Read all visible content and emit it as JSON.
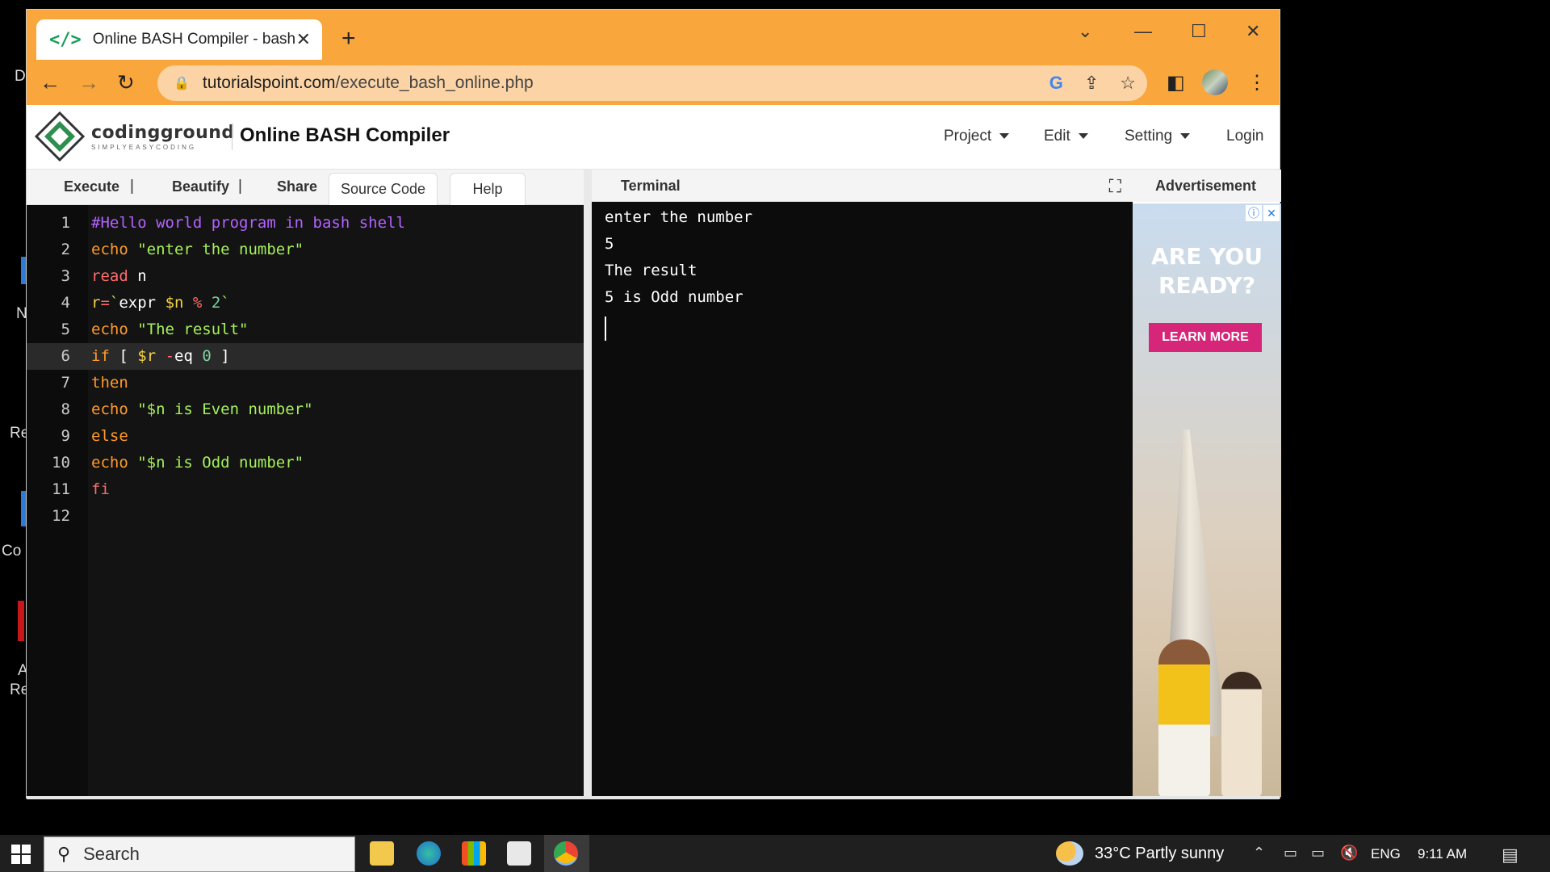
{
  "browser": {
    "tab_title": "Online BASH Compiler - bash",
    "url_host": "tutorialspoint.com",
    "url_path": "/execute_bash_online.php"
  },
  "desktop": {
    "fragments": [
      "D",
      "N",
      "Re",
      "Co",
      "A",
      "Re"
    ]
  },
  "site": {
    "logo_word": "codingground",
    "logo_sub": "SIMPLYEASYCODING",
    "title": "Online BASH Compiler",
    "menu": {
      "project": "Project",
      "edit": "Edit",
      "setting": "Setting",
      "login": "Login"
    },
    "toolbar": {
      "execute": "Execute",
      "beautify": "Beautify",
      "share": "Share",
      "source": "Source Code",
      "help": "Help"
    },
    "terminal_label": "Terminal",
    "advertisement_label": "Advertisement"
  },
  "editor": {
    "line_numbers": [
      "1",
      "2",
      "3",
      "4",
      "5",
      "6",
      "7",
      "8",
      "9",
      "10",
      "11",
      "12"
    ]
  },
  "terminal_output": [
    "enter the number",
    "5",
    "The result",
    "5 is Odd number"
  ],
  "ad": {
    "headline_1": "ARE YOU",
    "headline_2": "READY?",
    "cta": "LEARN MORE"
  },
  "taskbar": {
    "search_placeholder": "Search",
    "weather": "33°C  Partly sunny",
    "lang": "ENG",
    "time": "9:11 AM"
  },
  "colors": {
    "chrome_accent": "#f9a63c",
    "keyword": "#ff9a2b",
    "string": "#a6f05a",
    "comment": "#b362ff",
    "variable": "#f5d142"
  }
}
